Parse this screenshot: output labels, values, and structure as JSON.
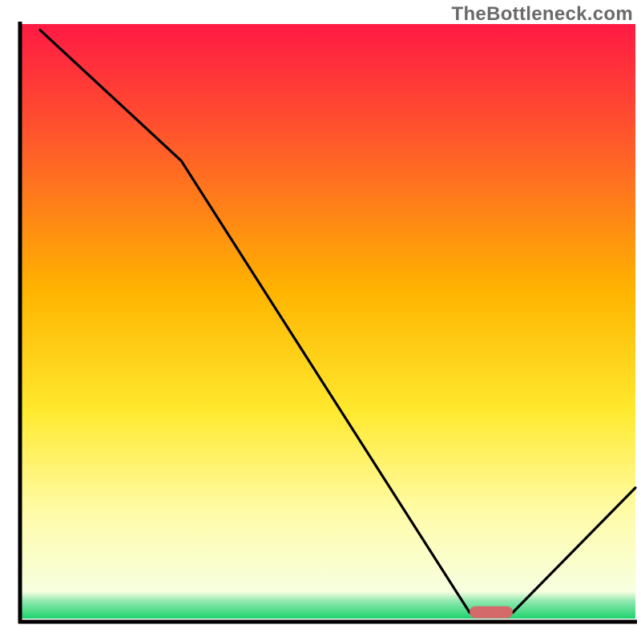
{
  "watermark": "TheBottleneck.com",
  "chart_data": {
    "type": "line",
    "title": "",
    "xlabel": "",
    "ylabel": "",
    "xlim": [
      0,
      100
    ],
    "ylim": [
      0,
      100
    ],
    "grid": false,
    "legend": false,
    "band_color_stops": [
      {
        "offset": 0.0,
        "color": "#ff1a44"
      },
      {
        "offset": 0.2,
        "color": "#ff5a2a"
      },
      {
        "offset": 0.45,
        "color": "#ffb400"
      },
      {
        "offset": 0.65,
        "color": "#ffe92e"
      },
      {
        "offset": 0.82,
        "color": "#fffca8"
      },
      {
        "offset": 0.955,
        "color": "#f7ffe0"
      },
      {
        "offset": 0.97,
        "color": "#93e9b0"
      },
      {
        "offset": 1.0,
        "color": "#1fd36e"
      }
    ],
    "series": [
      {
        "name": "bottleneck-curve",
        "x": [
          3.0,
          26.0,
          73.0,
          80.0,
          100.0
        ],
        "y": [
          99.0,
          77.0,
          1.0,
          1.0,
          22.0
        ]
      }
    ],
    "marker": {
      "name": "optimal-bar",
      "x_center": 76.5,
      "y": 1.0,
      "width_pct": 7.0,
      "color": "#d46a6a"
    },
    "axes": {
      "stroke": "#000000",
      "stroke_width": 5
    }
  }
}
